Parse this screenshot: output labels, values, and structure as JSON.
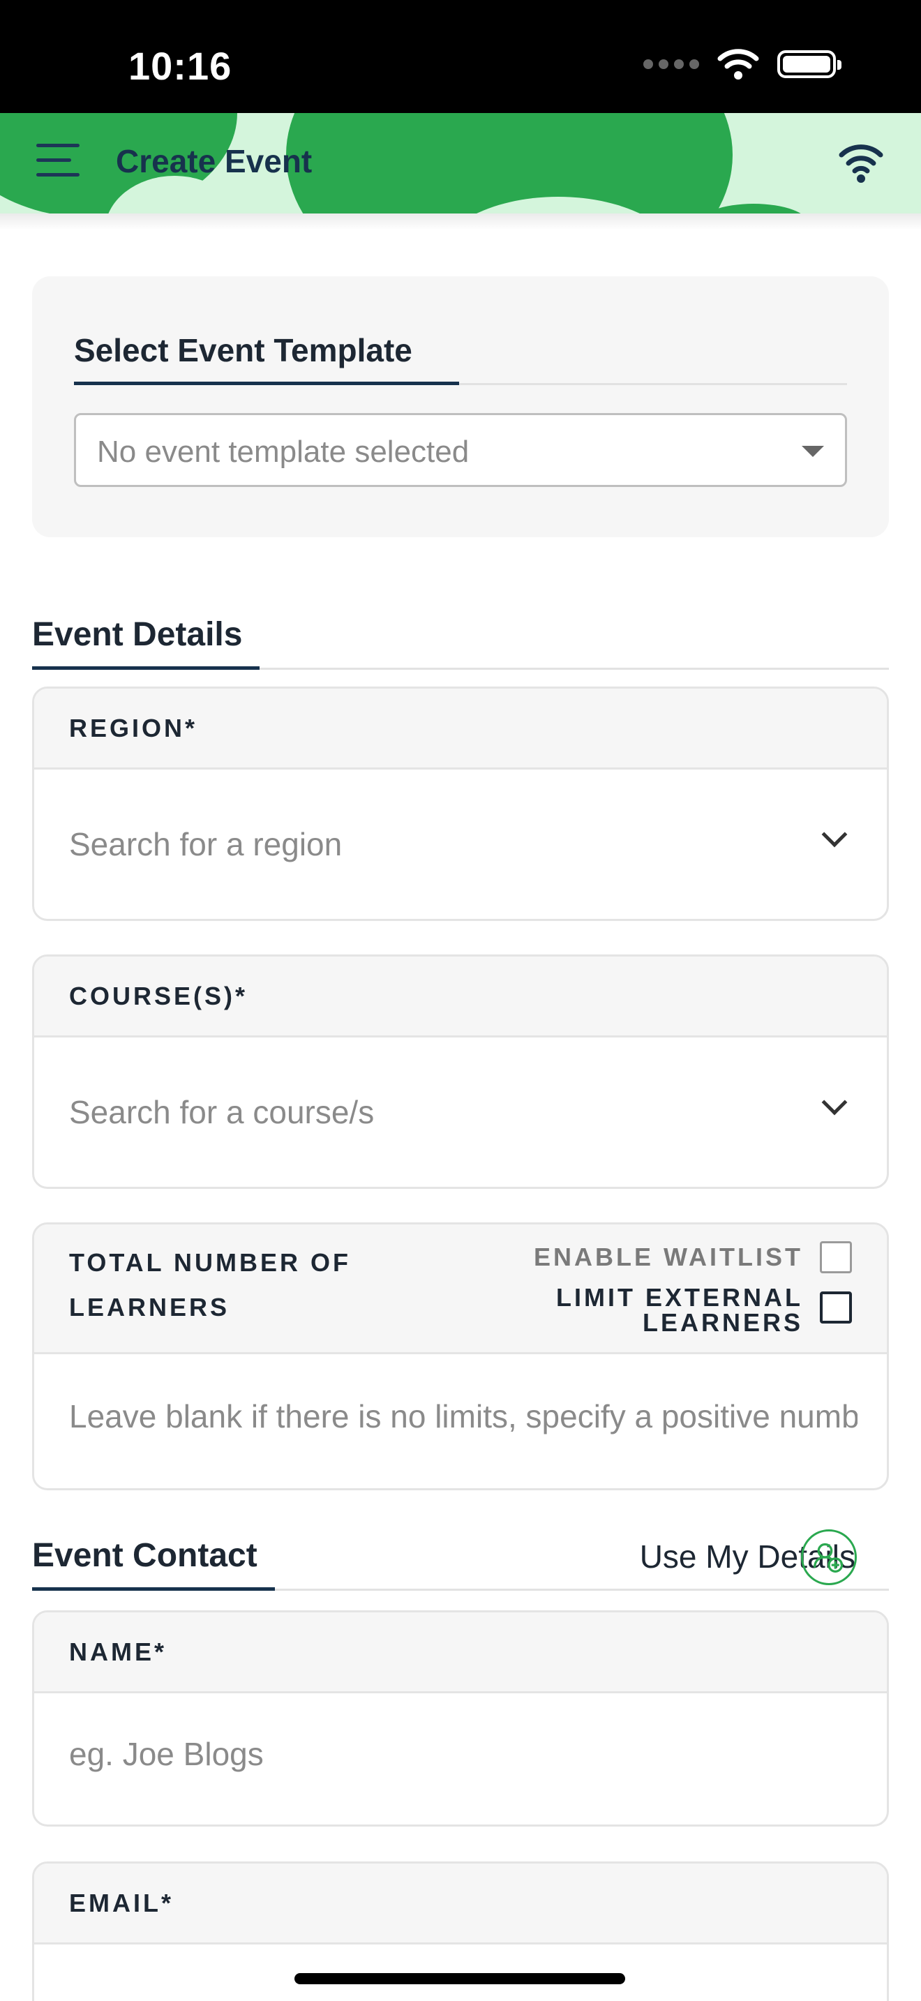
{
  "status_bar": {
    "time": "10:16"
  },
  "header": {
    "title": "Create Event"
  },
  "template_section": {
    "heading": "Select Event Template",
    "select_value": "No event template selected"
  },
  "event_details": {
    "heading": "Event Details",
    "region": {
      "label": "REGION*",
      "placeholder": "Search for a region"
    },
    "courses": {
      "label": "COURSE(S)*",
      "placeholder": "Search for a course/s"
    },
    "learners": {
      "label_line1": "TOTAL NUMBER OF",
      "label_line2": "LEARNERS",
      "enable_waitlist": "ENABLE WAITLIST",
      "limit_line1": "LIMIT EXTERNAL",
      "limit_line2": "LEARNERS",
      "placeholder": "Leave blank if there is no limits, specify a positive number"
    }
  },
  "event_contact": {
    "heading": "Event Contact",
    "use_my_details": "Use My Details",
    "name": {
      "label": "NAME*",
      "placeholder": "eg. Joe Blogs"
    },
    "email": {
      "label": "EMAIL*"
    }
  },
  "colors": {
    "brand_green": "#2aa84f",
    "header_bg": "#d4f5dc",
    "navy": "#17324d"
  },
  "icons": [
    "menu-icon",
    "wifi-icon",
    "chevron-down-icon",
    "user-add-icon"
  ]
}
